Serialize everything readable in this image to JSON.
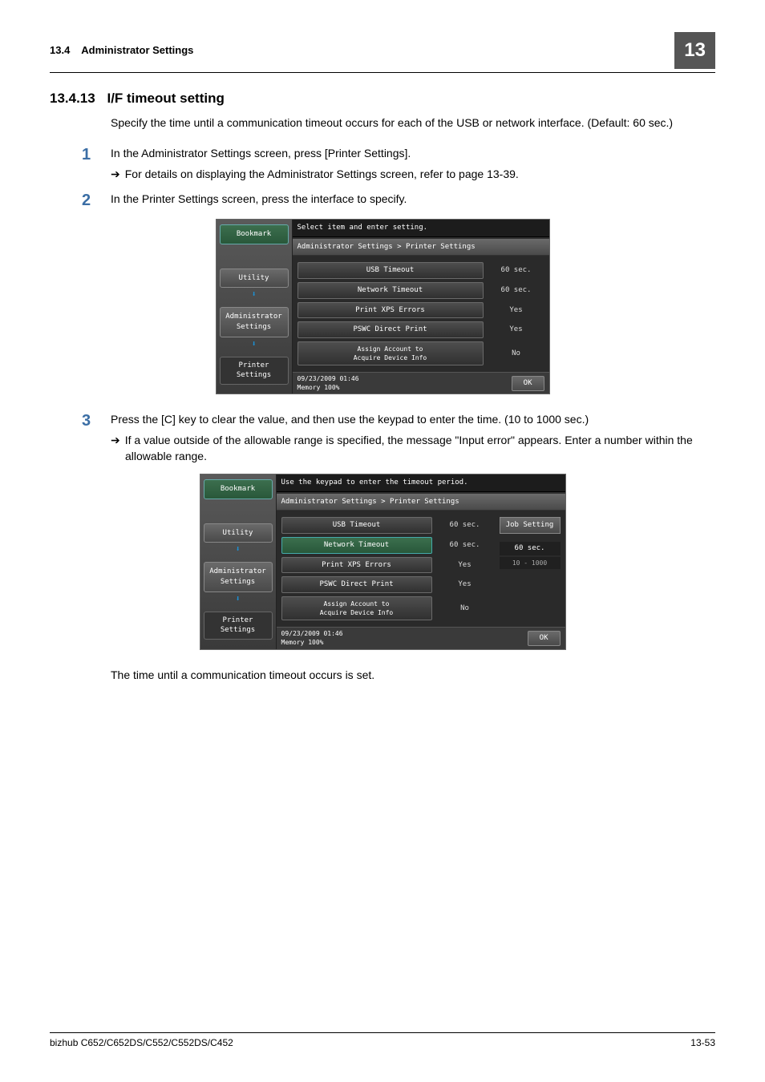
{
  "header": {
    "section_num": "13.4",
    "section_title": "Administrator Settings",
    "chapter": "13"
  },
  "heading": {
    "num": "13.4.13",
    "title": "I/F timeout setting"
  },
  "intro": "Specify the time until a communication timeout occurs for each of the USB or network interface. (Default: 60 sec.)",
  "steps": {
    "s1": {
      "num": "1",
      "text": "In the Administrator Settings screen, press [Printer Settings].",
      "sub": "For details on displaying the Administrator Settings screen, refer to page 13-39."
    },
    "s2": {
      "num": "2",
      "text": "In the Printer Settings screen, press the interface to specify."
    },
    "s3": {
      "num": "3",
      "text": "Press the [C] key to clear the value, and then use the keypad to enter the time. (10 to 1000 sec.)",
      "sub": "If a value outside of the allowable range is specified, the message \"Input error\" appears. Enter a number within the allowable range."
    }
  },
  "shot1": {
    "top": "Select item and enter setting.",
    "bc": "Administrator Settings > Printer Settings",
    "left": {
      "bookmark": "Bookmark",
      "utility": "Utility",
      "admin": "Administrator\nSettings",
      "printer": "Printer Settings"
    },
    "rows": {
      "r1l": "USB Timeout",
      "r1v": "60    sec.",
      "r2l": "Network Timeout",
      "r2v": "60    sec.",
      "r3l": "Print XPS Errors",
      "r3v": "Yes",
      "r4l": "PSWC Direct Print",
      "r4v": "Yes",
      "r5l": "Assign Account to\nAcquire Device Info",
      "r5v": "No"
    },
    "foot": {
      "date": "09/23/2009   01:46",
      "mem": "Memory      100%",
      "ok": "OK"
    }
  },
  "shot2": {
    "top": "Use the keypad to enter the timeout period.",
    "bc": "Administrator Settings > Printer Settings",
    "left": {
      "bookmark": "Bookmark",
      "utility": "Utility",
      "admin": "Administrator\nSettings",
      "printer": "Printer Settings"
    },
    "rows": {
      "r1l": "USB Timeout",
      "r1v": "60    sec.",
      "r2l": "Network Timeout",
      "r2v": "60    sec.",
      "r3l": "Print XPS Errors",
      "r3v": "Yes",
      "r4l": "PSWC Direct Print",
      "r4v": "Yes",
      "r5l": "Assign Account to\nAcquire Device Info",
      "r5v": "No"
    },
    "side": {
      "job": "Job Setting",
      "cur": "60    sec.",
      "range": "10  -  1000"
    },
    "foot": {
      "date": "09/23/2009   01:46",
      "mem": "Memory      100%",
      "ok": "OK"
    }
  },
  "closing": "The time until a communication timeout occurs is set.",
  "footer": {
    "left": "bizhub C652/C652DS/C552/C552DS/C452",
    "right": "13-53"
  }
}
